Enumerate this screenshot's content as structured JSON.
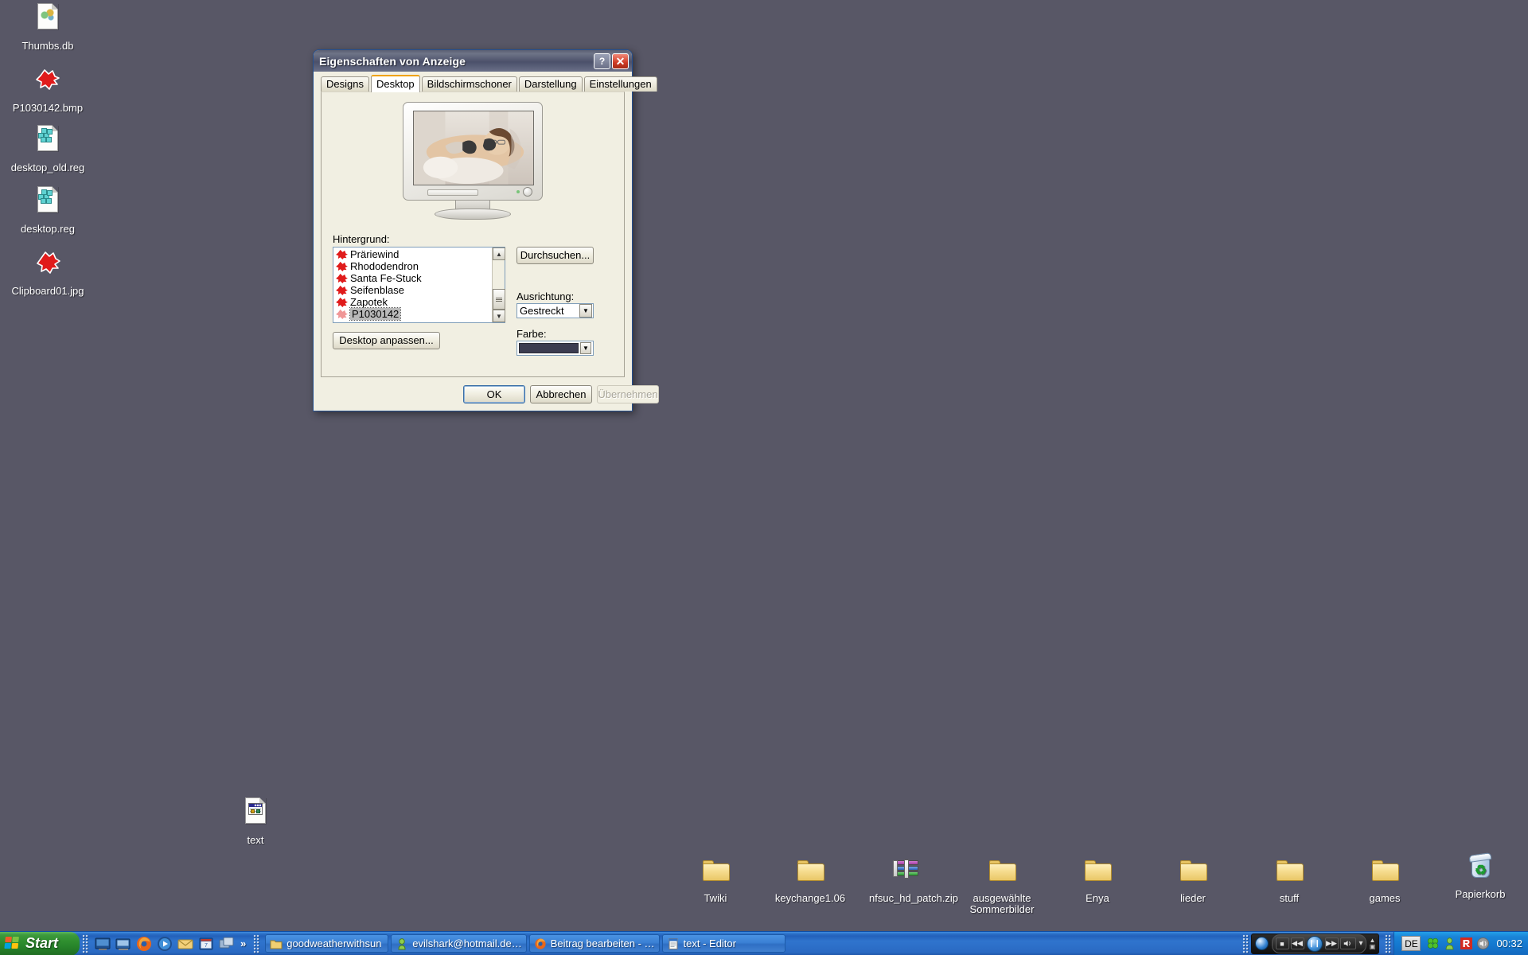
{
  "desktop": {
    "background_color": "#585766",
    "icons_left": [
      {
        "label": "Thumbs.db",
        "icon": "thumbnail-database-file-icon"
      },
      {
        "label": "P1030142.bmp",
        "icon": "bitmap-image-file-icon"
      },
      {
        "label": "desktop_old.reg",
        "icon": "registry-file-icon"
      },
      {
        "label": "desktop.reg",
        "icon": "registry-file-icon"
      },
      {
        "label": "Clipboard01.jpg",
        "icon": "jpeg-image-file-icon"
      }
    ],
    "icon_middle": {
      "label": "text",
      "icon": "html-document-file-icon"
    },
    "icons_bottom": [
      {
        "label": "Twiki",
        "icon": "folder-icon"
      },
      {
        "label": "keychange1.06",
        "icon": "folder-icon"
      },
      {
        "label": "nfsuc_hd_patch.zip",
        "icon": "winrar-archive-icon"
      },
      {
        "label": "ausgewählte\nSommerbilder",
        "icon": "folder-icon"
      },
      {
        "label": "Enya",
        "icon": "folder-icon"
      },
      {
        "label": "lieder",
        "icon": "folder-icon"
      },
      {
        "label": "stuff",
        "icon": "folder-icon"
      },
      {
        "label": "games",
        "icon": "folder-icon"
      },
      {
        "label": "Papierkorb",
        "icon": "recycle-bin-icon"
      }
    ]
  },
  "dialog": {
    "title": "Eigenschaften von Anzeige",
    "help_button": "?",
    "close_button": "✕",
    "tabs": [
      {
        "label": "Designs",
        "active": false
      },
      {
        "label": "Desktop",
        "active": true
      },
      {
        "label": "Bildschirmschoner",
        "active": false
      },
      {
        "label": "Darstellung",
        "active": false
      },
      {
        "label": "Einstellungen",
        "active": false
      }
    ],
    "preview": {
      "caption": "monitor-wallpaper-preview",
      "description": "Foto einer Person auf einem Sofa"
    },
    "background_label": "Hintergrund:",
    "background_list": [
      {
        "label": "Präriewind",
        "selected": false
      },
      {
        "label": "Rhododendron",
        "selected": false
      },
      {
        "label": "Santa Fe-Stuck",
        "selected": false
      },
      {
        "label": "Seifenblase",
        "selected": false
      },
      {
        "label": "Zapotek",
        "selected": false
      },
      {
        "label": "P1030142",
        "selected": true
      }
    ],
    "browse_button": "Durchsuchen...",
    "position_label": "Ausrichtung:",
    "position_value": "Gestreckt",
    "color_label": "Farbe:",
    "color_value": "#3c3c50",
    "customize_button": "Desktop anpassen...",
    "ok_button": "OK",
    "cancel_button": "Abbrechen",
    "apply_button": "Übernehmen",
    "apply_disabled": true,
    "scroll": {
      "up_arrow": "▲",
      "down_arrow": "▼"
    }
  },
  "taskbar": {
    "start_label": "Start",
    "quicklaunch": [
      {
        "name": "show-desktop-icon"
      },
      {
        "name": "minimize-windows-icon"
      },
      {
        "name": "firefox-icon"
      },
      {
        "name": "media-player-icon"
      },
      {
        "name": "mail-icon"
      },
      {
        "name": "calendar-icon"
      },
      {
        "name": "window-switch-icon"
      }
    ],
    "quicklaunch_overflow": "»",
    "windows": [
      {
        "label": "goodweatherwithsun",
        "icon": "folder-window-icon"
      },
      {
        "label": "evilshark@hotmail.de…",
        "icon": "messenger-icon"
      },
      {
        "label": "Beitrag bearbeiten - …",
        "icon": "firefox-icon"
      },
      {
        "label": "text - Editor",
        "icon": "notepad-icon"
      }
    ],
    "deskband": {
      "name": "windows-media-player-toolbar",
      "stop": "■",
      "previous": "◀◀",
      "pause": "❙❙",
      "next": "▶▶",
      "volume": "🔊",
      "volume_arrow": "▾"
    },
    "language": "DE",
    "tray_icons": [
      {
        "name": "clover-icon",
        "color": "#4fbf2f"
      },
      {
        "name": "person-icon",
        "color": "#7cc24a"
      },
      {
        "name": "antivirus-icon",
        "color": "#d42a1f"
      },
      {
        "name": "volume-icon",
        "color": "#8d8d8d"
      }
    ],
    "clock": "00:32"
  }
}
